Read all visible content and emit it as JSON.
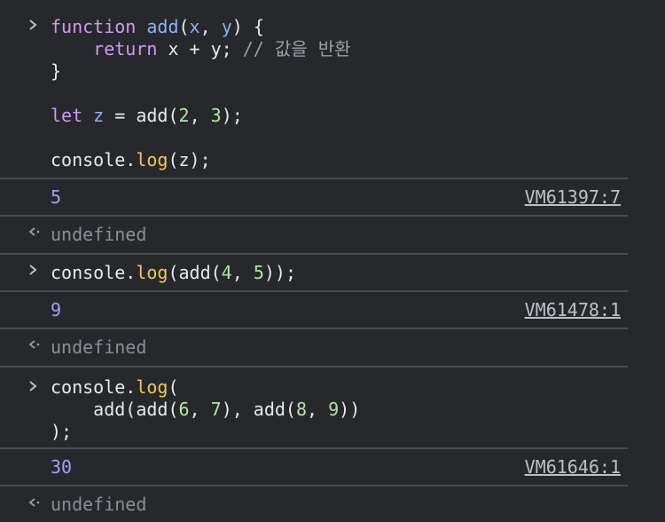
{
  "entries": [
    {
      "type": "input",
      "lines": [
        [
          {
            "t": "function",
            "c": "kw"
          },
          {
            "t": " ",
            "c": "plain"
          },
          {
            "t": "add",
            "c": "fn"
          },
          {
            "t": "(",
            "c": "plain"
          },
          {
            "t": "x",
            "c": "var"
          },
          {
            "t": ", ",
            "c": "plain"
          },
          {
            "t": "y",
            "c": "var"
          },
          {
            "t": ") {",
            "c": "plain"
          }
        ],
        [
          {
            "t": "    ",
            "c": "plain"
          },
          {
            "t": "return",
            "c": "kw"
          },
          {
            "t": " x + y; ",
            "c": "plain"
          },
          {
            "t": "// 값을 반환",
            "c": "cm"
          }
        ],
        [
          {
            "t": "}",
            "c": "plain"
          }
        ],
        [
          {
            "t": "",
            "c": "plain"
          }
        ],
        [
          {
            "t": "let",
            "c": "kw"
          },
          {
            "t": " ",
            "c": "plain"
          },
          {
            "t": "z",
            "c": "var"
          },
          {
            "t": " = add(",
            "c": "plain"
          },
          {
            "t": "2",
            "c": "num"
          },
          {
            "t": ", ",
            "c": "plain"
          },
          {
            "t": "3",
            "c": "num"
          },
          {
            "t": ");",
            "c": "plain"
          }
        ],
        [
          {
            "t": "",
            "c": "plain"
          }
        ],
        [
          {
            "t": "console.",
            "c": "plain"
          },
          {
            "t": "log",
            "c": "prop"
          },
          {
            "t": "(z);",
            "c": "plain"
          }
        ]
      ]
    },
    {
      "type": "log",
      "value": "5",
      "source": "VM61397:7"
    },
    {
      "type": "result",
      "value": "undefined"
    },
    {
      "type": "input",
      "lines": [
        [
          {
            "t": "console.",
            "c": "plain"
          },
          {
            "t": "log",
            "c": "prop"
          },
          {
            "t": "(add(",
            "c": "plain"
          },
          {
            "t": "4",
            "c": "num"
          },
          {
            "t": ", ",
            "c": "plain"
          },
          {
            "t": "5",
            "c": "num"
          },
          {
            "t": "));",
            "c": "plain"
          }
        ]
      ]
    },
    {
      "type": "log",
      "value": "9",
      "source": "VM61478:1"
    },
    {
      "type": "result",
      "value": "undefined"
    },
    {
      "type": "input",
      "lines": [
        [
          {
            "t": "console.",
            "c": "plain"
          },
          {
            "t": "log",
            "c": "prop"
          },
          {
            "t": "(",
            "c": "plain"
          }
        ],
        [
          {
            "t": "    add(add(",
            "c": "plain"
          },
          {
            "t": "6",
            "c": "num"
          },
          {
            "t": ", ",
            "c": "plain"
          },
          {
            "t": "7",
            "c": "num"
          },
          {
            "t": "), add(",
            "c": "plain"
          },
          {
            "t": "8",
            "c": "num"
          },
          {
            "t": ", ",
            "c": "plain"
          },
          {
            "t": "9",
            "c": "num"
          },
          {
            "t": "))",
            "c": "plain"
          }
        ],
        [
          {
            "t": ");",
            "c": "plain"
          }
        ]
      ]
    },
    {
      "type": "log",
      "value": "30",
      "source": "VM61646:1"
    },
    {
      "type": "result",
      "value": "undefined"
    }
  ],
  "colors": {
    "background": "#27282b",
    "keyword": "#d19af6",
    "function_name": "#8fb3ff",
    "number": "#b3e5a8",
    "property": "#f2c94c",
    "comment": "#9aa0a6",
    "log_number": "#a89dff",
    "undefined": "#8b8f96",
    "separator": "#4a4c50"
  }
}
